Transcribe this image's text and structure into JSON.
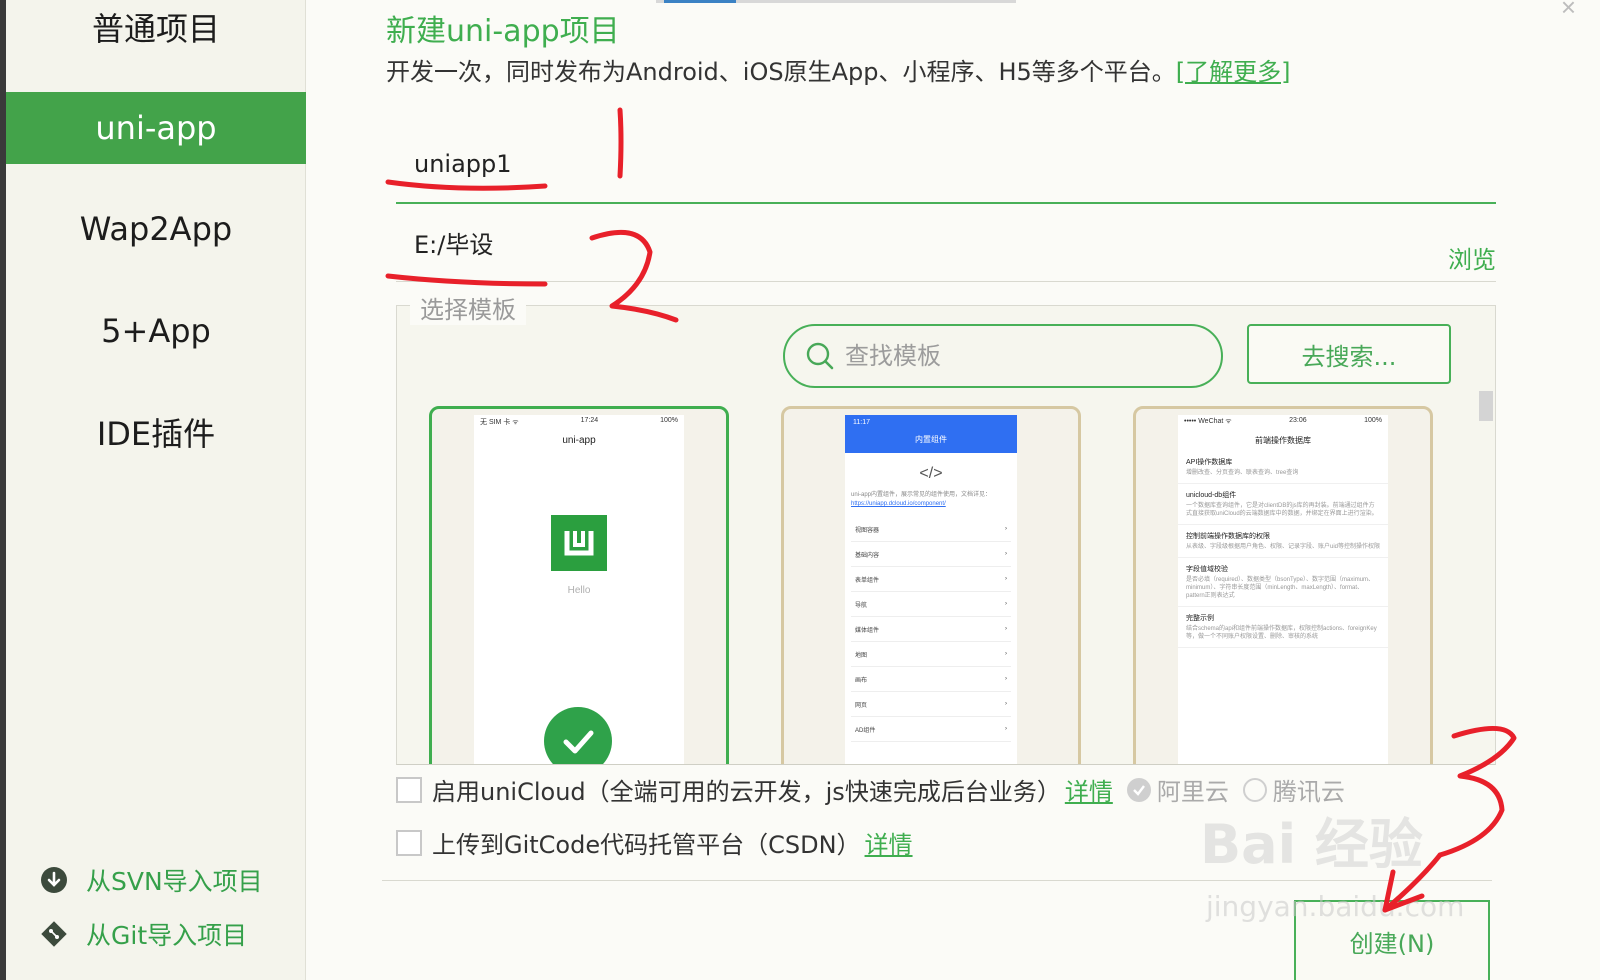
{
  "sidebar": {
    "items": [
      {
        "label": "普通项目"
      },
      {
        "label": "uni-app"
      },
      {
        "label": "Wap2App"
      },
      {
        "label": "5+App"
      },
      {
        "label": "IDE插件"
      }
    ],
    "active_index": 1,
    "import_svn": "从SVN导入项目",
    "import_git": "从Git导入项目"
  },
  "main": {
    "title": "新建uni-app项目",
    "subtitle": "开发一次，同时发布为Android、iOS原生App、小程序、H5等多个平台。",
    "learn_more": "[了解更多]",
    "project_name": "uniapp1",
    "project_path": "E:/毕设",
    "browse_label": "浏览",
    "template_legend": "选择模板",
    "search_placeholder": "查找模板",
    "go_search_label": "去搜索...",
    "close_glyph": "×"
  },
  "templates": [
    {
      "selected": true,
      "phone_status_left": "无 SIM 卡 ᯤ",
      "phone_time": "17:24",
      "phone_status_right": "100%",
      "phone_title": "uni-app",
      "phone_text": "Hello"
    },
    {
      "selected": false,
      "phone_time": "11:17",
      "phone_title": "内置组件",
      "code_glyph": "</>",
      "intro": "uni-app内置组件，展示常见的组件使用，文档详见：",
      "intro_link": "https://uniapp.dcloud.io/component/",
      "rows": [
        "视图容器",
        "基础内容",
        "表单组件",
        "导航",
        "媒体组件",
        "地图",
        "画布",
        "网页",
        "AD组件"
      ]
    },
    {
      "selected": false,
      "phone_status_left": "••••• WeChat ᯤ",
      "phone_time": "23:06",
      "phone_status_right": "100%",
      "phone_title": "前端操作数据库",
      "items": [
        {
          "h": "API操作数据库",
          "d": "增删改查、分页查询、联表查询、tree查询"
        },
        {
          "h": "unicloud-db组件",
          "d": "一个数据库查询组件，它是对clientDB的js库的再封装。前端通过组件方式直接获取uniCloud的云端数据库中的数据，并绑定在界面上进行渲染。"
        },
        {
          "h": "控制前端操作数据库的权限",
          "d": "从表级、字段级根据用户角色、权限、记录字段、账户uid等控制操作权限"
        },
        {
          "h": "字段值域校验",
          "d": "是否必填（required）、数据类型（bsonType）、数字范围（maximum、minimum）、字符串长度范围（minLength、maxLength）、format、pattern正则表达式"
        },
        {
          "h": "完整示例",
          "d": "结合schema的api和组件前端操作数据库，权限控制actions、foreignKey等，做一个不同账户权限设置、删除、审核的系统"
        }
      ]
    }
  ],
  "options": {
    "unicloud_label": "启用uniCloud（全端可用的云开发，js快速完成后台业务）",
    "unicloud_detail": "详情",
    "provider_aliyun": "阿里云",
    "provider_tencent": "腾讯云",
    "gitcode_label": "上传到GitCode代码托管平台（CSDN）",
    "gitcode_detail": "详情"
  },
  "create_label": "创建(N)",
  "annotations": {
    "mark_1": "1",
    "mark_2": "2",
    "mark_3": "3",
    "color": "#e8202a"
  },
  "watermark": {
    "text": "Bai  经验",
    "sub": "jingyan.baidu.com"
  },
  "colors": {
    "accent": "#43a34a",
    "sidebar_bg": "#f4f4ec",
    "page_bg": "#fbfbf7"
  }
}
